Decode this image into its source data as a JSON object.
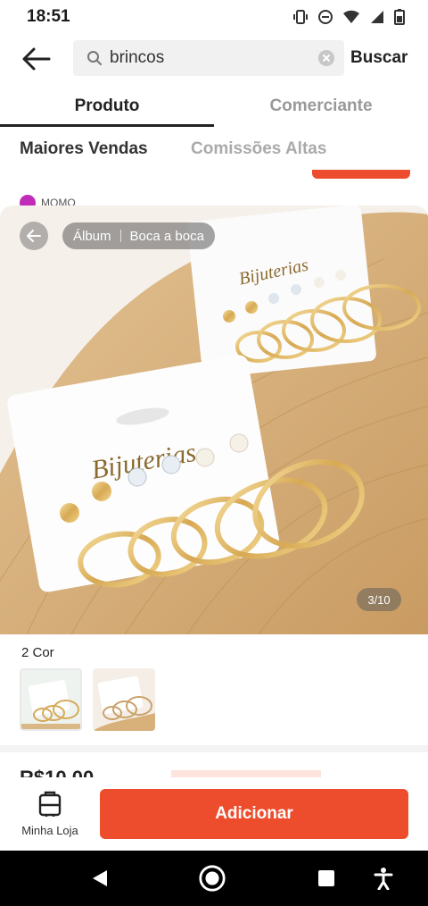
{
  "status_bar": {
    "time": "18:51",
    "icons": [
      "vibrate-icon",
      "dnd-icon",
      "wifi-icon",
      "signal-icon",
      "battery-icon"
    ]
  },
  "search": {
    "value": "brincos",
    "submit_label": "Buscar"
  },
  "tabs": [
    {
      "label": "Produto",
      "active": true
    },
    {
      "label": "Comerciante",
      "active": false
    }
  ],
  "sort": {
    "top_sales": "Maiores Vendas",
    "high_commission": "Comissões Altas"
  },
  "background_peek": {
    "store_name": "MOMO"
  },
  "product_sheet": {
    "view_modes": [
      "Álbum",
      "Boca a boca"
    ],
    "photo_brand_text": "Bijuterias",
    "image_counter": "3/10",
    "variant_label": "2 Cor"
  },
  "price": {
    "current": "R$10,00"
  },
  "action_bar": {
    "store_label": "Minha Loja",
    "add_label": "Adicionar"
  },
  "colors": {
    "accent": "#ee4d2d",
    "active_tab": "#222222",
    "inactive_tab": "#999999"
  }
}
